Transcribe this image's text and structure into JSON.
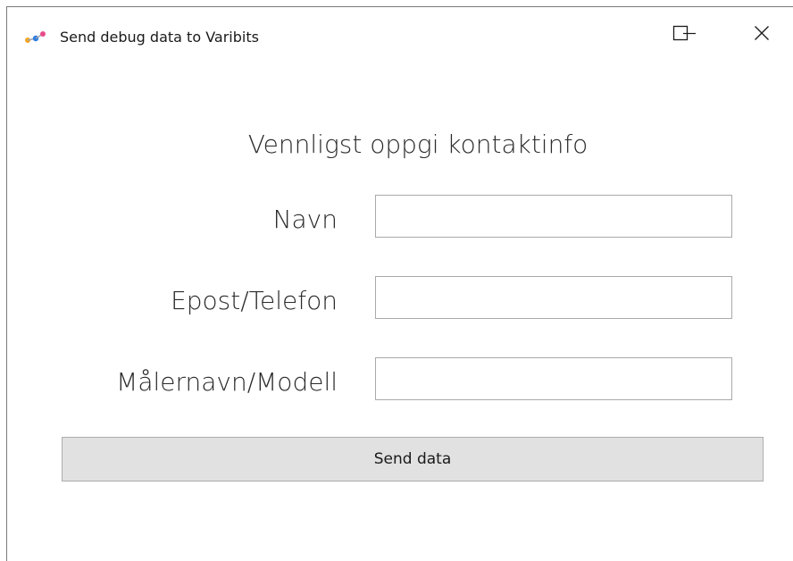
{
  "window": {
    "title": "Send debug data to Varibits",
    "icon": "varibits-app-icon"
  },
  "caption_buttons": {
    "minimize_icon": "minimize-icon",
    "maximize_icon": "maximize-icon",
    "close_icon": "close-icon"
  },
  "form": {
    "heading": "Vennligst oppgi kontaktinfo",
    "fields": [
      {
        "label": "Navn",
        "value": "",
        "placeholder": ""
      },
      {
        "label": "Epost/Telefon",
        "value": "",
        "placeholder": ""
      },
      {
        "label": "Målernavn/Modell",
        "value": "",
        "placeholder": ""
      }
    ],
    "submit_label": "Send data"
  },
  "colors": {
    "button_bg": "#e1e1e1",
    "button_border": "#adadad",
    "input_border": "#a9a9a9",
    "icon_orange": "#f5a623",
    "icon_blue": "#2f7de1",
    "icon_pink": "#e94b8a"
  }
}
